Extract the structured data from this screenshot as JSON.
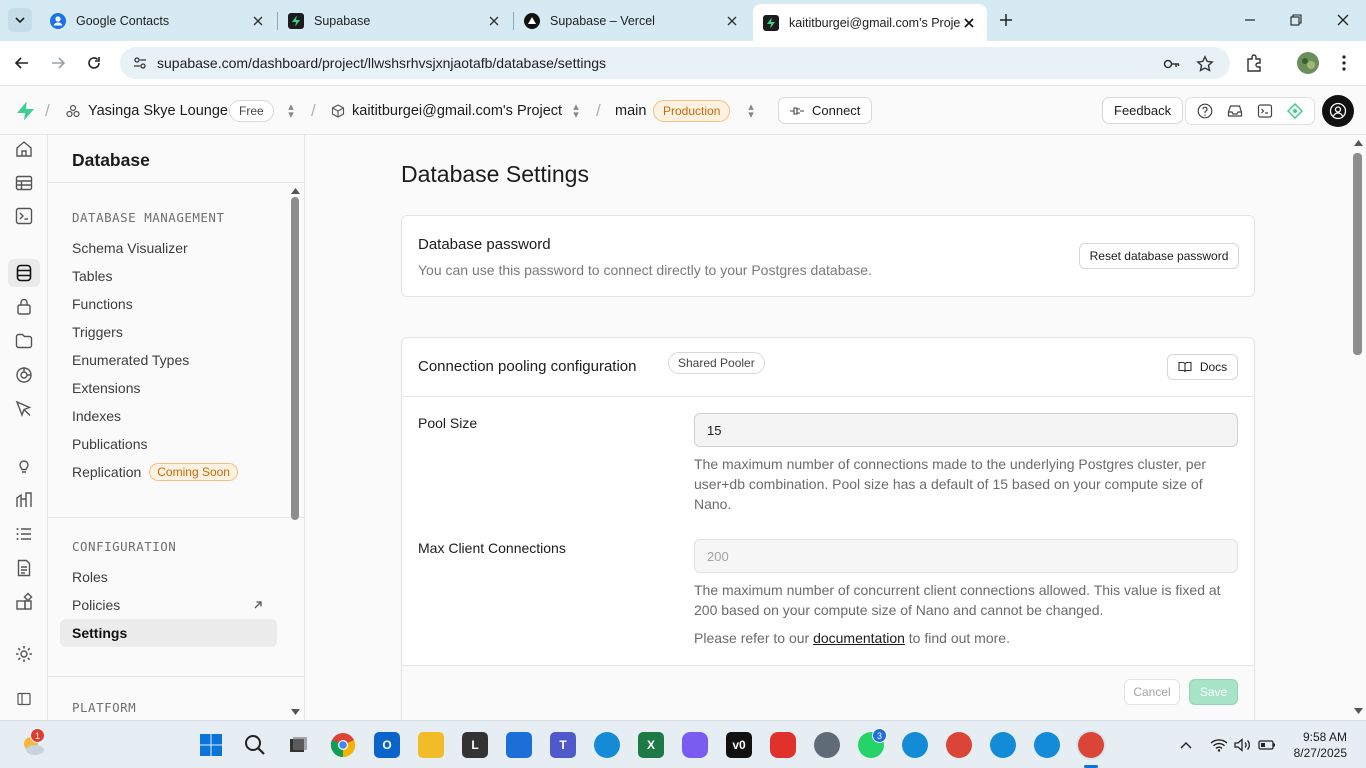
{
  "browser": {
    "tabs": [
      {
        "title": "Google Contacts",
        "icon": "google-contacts-icon"
      },
      {
        "title": "Supabase",
        "icon": "supabase-icon"
      },
      {
        "title": "Supabase – Vercel",
        "icon": "vercel-icon"
      },
      {
        "title": "kaititburgei@gmail.com's Project",
        "icon": "supabase-icon",
        "active": true
      }
    ],
    "url": "supabase.com/dashboard/project/llwshsrhvsjxnjaotafb/database/settings"
  },
  "topnav": {
    "org": "Yasinga Skye Lounge",
    "org_plan": "Free",
    "project": "kaititburgei@gmail.com's Project",
    "branch": "main",
    "branch_env": "Production",
    "connect_label": "Connect",
    "feedback_label": "Feedback"
  },
  "sidebar": {
    "title": "Database",
    "sections": [
      {
        "heading": "DATABASE MANAGEMENT",
        "items": [
          {
            "label": "Schema Visualizer"
          },
          {
            "label": "Tables"
          },
          {
            "label": "Functions"
          },
          {
            "label": "Triggers"
          },
          {
            "label": "Enumerated Types"
          },
          {
            "label": "Extensions"
          },
          {
            "label": "Indexes"
          },
          {
            "label": "Publications"
          },
          {
            "label": "Replication",
            "badge": "Coming Soon"
          }
        ]
      },
      {
        "heading": "CONFIGURATION",
        "items": [
          {
            "label": "Roles"
          },
          {
            "label": "Policies",
            "external": true
          },
          {
            "label": "Settings",
            "active": true
          }
        ]
      },
      {
        "heading": "PLATFORM",
        "items": []
      }
    ]
  },
  "main": {
    "title": "Database Settings",
    "password_card": {
      "title": "Database password",
      "description": "You can use this password to connect directly to your Postgres database.",
      "reset_label": "Reset database password"
    },
    "pooling_card": {
      "title": "Connection pooling configuration",
      "badge": "Shared Pooler",
      "docs_label": "Docs",
      "pool_size_label": "Pool Size",
      "pool_size_value": "15",
      "pool_size_help": "The maximum number of connections made to the underlying Postgres cluster, per user+db combination. Pool size has a default of 15 based on your compute size of Nano.",
      "max_client_label": "Max Client Connections",
      "max_client_value": "200",
      "max_client_help": "The maximum number of concurrent client connections allowed. This value is fixed at 200 based on your compute size of Nano and cannot be changed.",
      "refer_prefix": "Please refer to our ",
      "refer_link": "documentation",
      "refer_suffix": " to find out more.",
      "cancel_label": "Cancel",
      "save_label": "Save"
    }
  },
  "taskbar": {
    "weather_badge": "1",
    "whatsapp_badge": "3",
    "time": "9:58 AM",
    "date": "8/27/2025"
  },
  "colors": {
    "supabase_green": "#3ecf8e",
    "production_orange": "#c56a09",
    "save_disabled": "#a7e3c6"
  }
}
